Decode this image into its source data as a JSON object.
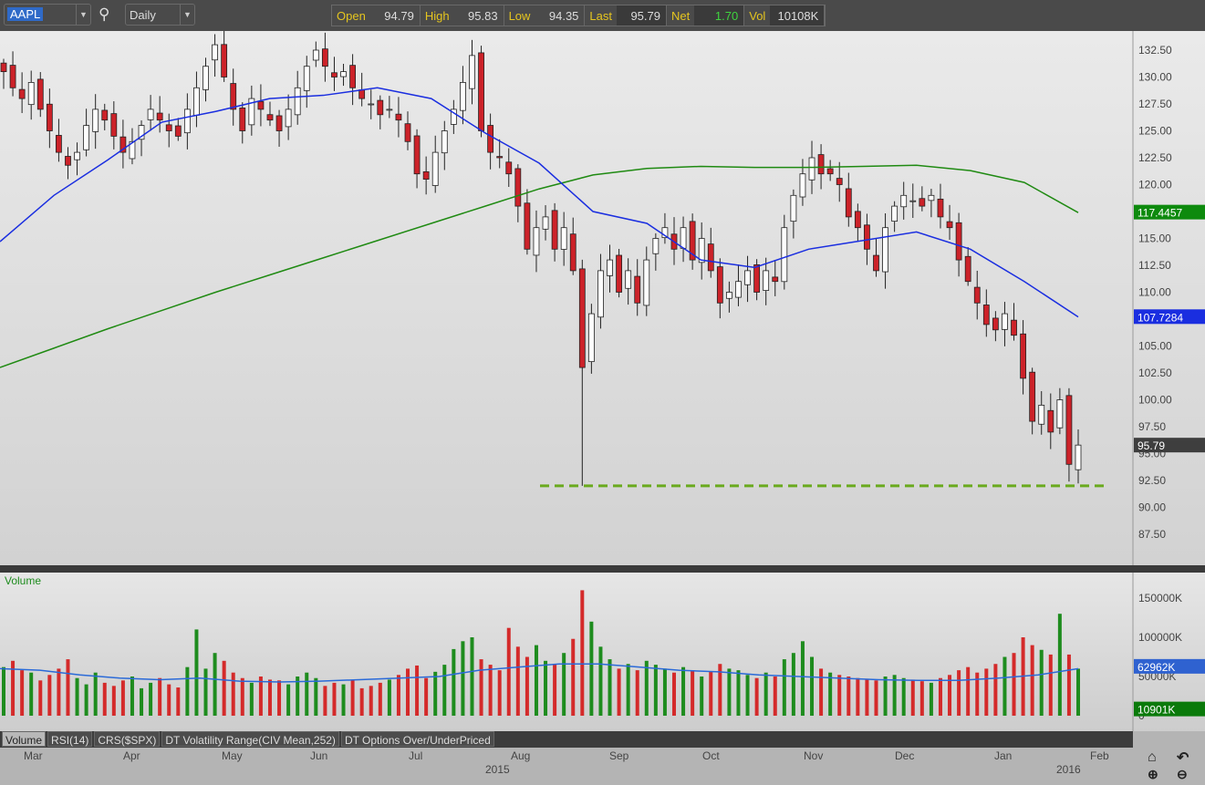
{
  "toolbar": {
    "symbol": "AAPL",
    "interval": "Daily",
    "quote": [
      {
        "k": "Open",
        "v": "94.79"
      },
      {
        "k": "High",
        "v": "95.83"
      },
      {
        "k": "Low",
        "v": "94.35"
      },
      {
        "k": "Last",
        "v": "95.79"
      },
      {
        "k": "Net",
        "v": "1.70"
      },
      {
        "k": "Vol",
        "v": "10108K"
      }
    ]
  },
  "tabs": [
    "Volume",
    "RSI(14)",
    "CRS($SPX)",
    "DT Volatility Range(CIV Mean,252)",
    "DT Options Over/UnderPriced"
  ],
  "colors": {
    "up": "#ffffff",
    "down": "#cc2229",
    "vol_up": "#1e8c1e",
    "vol_down": "#d42a2a",
    "ma50": "#1a2ee0",
    "ma200": "#1f8a12",
    "support": "#6aaa1e",
    "net": "#3fd43f"
  },
  "chart_data": [
    {
      "type": "candlestick",
      "title": "AAPL Daily",
      "ylim": [
        85.5,
        134.5
      ],
      "yticks": [
        "132.50",
        "130.00",
        "127.50",
        "125.00",
        "122.50",
        "120.00",
        "117.50",
        "115.00",
        "112.50",
        "110.00",
        "107.50",
        "105.00",
        "102.50",
        "100.00",
        "97.50",
        "95.00",
        "92.50",
        "90.00",
        "87.50"
      ],
      "xticks": [
        "Mar",
        "Apr",
        "May",
        "Jun",
        "Jul",
        "Aug",
        "Sep",
        "Oct",
        "Nov",
        "Dec",
        "Jan",
        "Feb"
      ],
      "year_labels": [
        "2015",
        "2016"
      ],
      "closes": [
        130.5,
        129,
        128,
        129.5,
        127,
        125,
        123,
        121.8,
        123,
        125.5,
        127,
        126,
        124.5,
        123,
        124,
        125.5,
        127,
        126,
        125,
        124.5,
        127,
        129,
        131,
        133,
        130,
        127,
        125,
        128,
        127,
        126,
        125,
        127,
        129,
        131,
        132.5,
        131,
        130,
        130.5,
        129,
        128,
        127.5,
        126.5,
        127,
        126,
        124,
        121,
        120.5,
        123,
        125,
        127,
        129.5,
        132,
        125,
        123,
        122.5,
        121,
        118,
        114,
        116,
        117,
        114,
        116,
        112,
        103,
        108,
        112,
        113,
        110,
        112,
        109,
        113,
        115,
        116,
        114,
        116,
        113,
        115,
        112,
        109,
        110,
        111,
        112,
        110,
        112,
        111,
        116,
        119,
        121,
        122.5,
        121,
        121,
        120,
        117,
        116,
        114,
        112,
        116,
        118,
        119,
        118.5,
        118,
        119,
        117,
        116,
        113,
        111,
        109,
        107,
        106.5,
        108,
        106,
        102,
        98,
        99.5,
        97,
        100,
        94,
        95.79
      ],
      "last_low_wick": 92,
      "ma50": {
        "label": "107.7284",
        "values": [
          114.7,
          119,
          122.3,
          125.8,
          126.8,
          128,
          128.3,
          129,
          128,
          124.8,
          122,
          117.5,
          116.4,
          113,
          112.3,
          114,
          114.8,
          115.6,
          114,
          111,
          107.7
        ]
      },
      "ma200": {
        "label": "117.4457",
        "values": [
          103,
          104.8,
          106.6,
          108.3,
          110,
          111.6,
          113.2,
          114.8,
          116.4,
          118,
          119.6,
          120.9,
          121.5,
          121.7,
          121.6,
          121.6,
          121.7,
          121.8,
          121.3,
          120.2,
          117.4
        ]
      },
      "last_label": "95.79",
      "support_level": 92
    },
    {
      "type": "bar",
      "title": "Volume",
      "ylim": [
        0,
        180000
      ],
      "yticks": [
        "150000K",
        "100000K",
        "50000K",
        "0"
      ],
      "volumes": [
        62000,
        70000,
        58000,
        55000,
        45000,
        52000,
        60000,
        72000,
        48000,
        40000,
        55000,
        42000,
        38000,
        45000,
        50000,
        35000,
        42000,
        48000,
        40000,
        36000,
        62000,
        110000,
        60000,
        80000,
        70000,
        55000,
        48000,
        42000,
        50000,
        46000,
        45000,
        40000,
        50000,
        55000,
        48000,
        38000,
        42000,
        40000,
        45000,
        35000,
        38000,
        42000,
        46000,
        52000,
        60000,
        64000,
        48000,
        56000,
        65000,
        85000,
        95000,
        100000,
        72000,
        65000,
        58000,
        112000,
        88000,
        75000,
        90000,
        70000,
        66000,
        80000,
        98000,
        160000,
        120000,
        88000,
        72000,
        60000,
        66000,
        58000,
        70000,
        65000,
        60000,
        55000,
        62000,
        58000,
        50000,
        56000,
        66000,
        60000,
        58000,
        52000,
        48000,
        55000,
        50000,
        72000,
        80000,
        95000,
        75000,
        60000,
        55000,
        52000,
        50000,
        48000,
        46000,
        45000,
        50000,
        52000,
        48000,
        46000,
        44000,
        42000,
        48000,
        52000,
        58000,
        62000,
        55000,
        60000,
        66000,
        75000,
        80000,
        100000,
        90000,
        84000,
        78000,
        130000,
        78000,
        60000
      ],
      "vol_ma": [
        60000,
        58000,
        52000,
        48000,
        46000,
        48000,
        44000,
        43000,
        44000,
        46000,
        48000,
        50000,
        58000,
        62000,
        66000,
        66000,
        62000,
        58000,
        56000,
        52000,
        50000,
        48000,
        46000,
        45000,
        45000,
        48000,
        52000,
        60000
      ],
      "avg_label": "62962K",
      "last_label": "10901K"
    }
  ]
}
